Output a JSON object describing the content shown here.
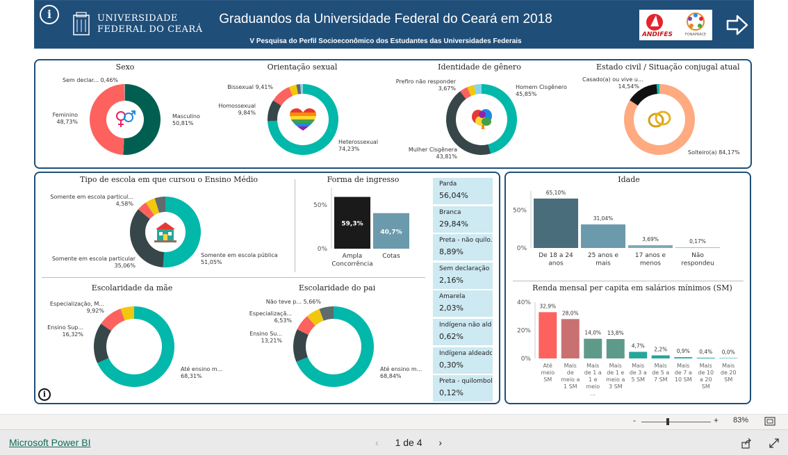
{
  "header": {
    "title": "Graduandos da Universidade Federal do Ceará em 2018",
    "subtitle": "V Pesquisa do Perfil Socioeconômico dos Estudantes das Universidades Federais",
    "university_line1": "Universidade",
    "university_line2": "Federal do Ceará",
    "partner1": "ANDIFES",
    "partner2": "FONAPRACE",
    "info_icon": "i",
    "nav_icon": "arrow-right-icon",
    "colors": {
      "header_bg": "#1f4e79",
      "teal": "#01b8aa",
      "dark": "#374649",
      "red": "#fd625e",
      "yellow": "#f2c80f",
      "gray": "#5f6b6d"
    }
  },
  "charts": {
    "sexo": {
      "title": "Sexo",
      "labels": [
        {
          "name": "Sem declar...",
          "pct": "0,46%"
        },
        {
          "name": "Feminino",
          "pct": "48,73%"
        },
        {
          "name": "Masculino",
          "pct": "50,81%"
        }
      ]
    },
    "orientacao": {
      "title": "Orientação sexual",
      "labels": [
        {
          "name": "Bissexual",
          "pct": "9,41%"
        },
        {
          "name": "Homossexual",
          "pct": "9,84%"
        },
        {
          "name": "Heterossexual",
          "pct": "74,23%"
        }
      ]
    },
    "genero": {
      "title": "Identidade de gênero",
      "labels": [
        {
          "name": "Prefiro não responder",
          "pct": "3,67%"
        },
        {
          "name": "Homem Cisgênero",
          "pct": "45,85%"
        },
        {
          "name": "Mulher Cisgênera",
          "pct": "43,81%"
        }
      ]
    },
    "civil": {
      "title": "Estado civil / Situação conjugal atual",
      "labels": [
        {
          "name": "Casado(a) ou vive u...",
          "pct": "14,54%"
        },
        {
          "name": "Solteiro(a)",
          "pct": "84,17%"
        }
      ]
    },
    "escola": {
      "title": "Tipo de escola em que cursou o Ensino Médio",
      "labels": [
        {
          "name": "Somente em escola particul...",
          "pct": "4,58%"
        },
        {
          "name": "Somente em escola particular",
          "pct": "35,06%"
        },
        {
          "name": "Somente em escola pública",
          "pct": "51,05%"
        }
      ]
    },
    "mae": {
      "title": "Escolaridade da mãe",
      "labels": [
        {
          "name": "Especialização, M...",
          "pct": "9,92%"
        },
        {
          "name": "Ensino Sup...",
          "pct": "16,32%"
        },
        {
          "name": "Até ensino m...",
          "pct": "68,31%"
        }
      ]
    },
    "pai": {
      "title": "Escolaridade do pai",
      "labels": [
        {
          "name": "Não teve p...",
          "pct": "5,66%"
        },
        {
          "name": "Especializaçã...",
          "pct": "6,53%"
        },
        {
          "name": "Ensino Su...",
          "pct": "13,21%"
        },
        {
          "name": "Até ensino m...",
          "pct": "68,84%"
        }
      ]
    }
  },
  "chart_data": [
    {
      "type": "pie",
      "title": "Sexo",
      "categories": [
        "Masculino",
        "Feminino",
        "Sem declar..."
      ],
      "values": [
        50.81,
        48.73,
        0.46
      ]
    },
    {
      "type": "pie",
      "title": "Orientação sexual",
      "categories": [
        "Heterossexual",
        "Homossexual",
        "Bissexual"
      ],
      "values": [
        74.23,
        9.84,
        9.41
      ]
    },
    {
      "type": "pie",
      "title": "Identidade de gênero",
      "categories": [
        "Homem Cisgênero",
        "Mulher Cisgênera",
        "Prefiro não responder"
      ],
      "values": [
        45.85,
        43.81,
        3.67
      ]
    },
    {
      "type": "pie",
      "title": "Estado civil / Situação conjugal atual",
      "categories": [
        "Solteiro(a)",
        "Casado(a) ou vive u..."
      ],
      "values": [
        84.17,
        14.54
      ]
    },
    {
      "type": "pie",
      "title": "Tipo de escola em que cursou o Ensino Médio",
      "categories": [
        "Somente em escola pública",
        "Somente em escola particular",
        "Somente em escola particul..."
      ],
      "values": [
        51.05,
        35.06,
        4.58
      ]
    },
    {
      "type": "pie",
      "title": "Escolaridade da mãe",
      "categories": [
        "Até ensino m...",
        "Ensino Sup...",
        "Especialização, M..."
      ],
      "values": [
        68.31,
        16.32,
        9.92
      ]
    },
    {
      "type": "pie",
      "title": "Escolaridade do pai",
      "categories": [
        "Até ensino m...",
        "Ensino Su...",
        "Especializaçã...",
        "Não teve p..."
      ],
      "values": [
        68.84,
        13.21,
        6.53,
        5.66
      ]
    },
    {
      "type": "bar",
      "title": "Forma de ingresso",
      "categories": [
        "Ampla Concorrência",
        "Cotas"
      ],
      "values": [
        59.3,
        40.7
      ],
      "value_labels": [
        "59,3%",
        "40,7%"
      ],
      "yticks": [
        "50%",
        "0%"
      ],
      "ylim": [
        0,
        70
      ],
      "colors": [
        "#1a1a1a",
        "#6a9aab"
      ]
    },
    {
      "type": "bar",
      "title": "Idade",
      "categories": [
        "De 18 a 24 anos",
        "25 anos e mais",
        "17 anos e menos",
        "Não respondeu"
      ],
      "values": [
        65.1,
        31.04,
        3.69,
        0.17
      ],
      "value_labels": [
        "65,10%",
        "31,04%",
        "3,69%",
        "0,17%"
      ],
      "yticks": [
        "50%",
        "0%"
      ],
      "ylim": [
        0,
        75
      ],
      "colors": [
        "#4a6d7c",
        "#6a9aab",
        "#7fa9b8",
        "#9cc0cc"
      ]
    },
    {
      "type": "bar",
      "title": "Renda mensal per capita em salários mínimos (SM)",
      "categories": [
        "Até meio SM",
        "Mais de meio a 1 SM",
        "Mais de 1 a 1 e meio ...",
        "Mais de 1 e meio a 3 SM",
        "Mais de 3 a 5 SM",
        "Mais de 5 a 7 SM",
        "Mais de 7 a 10 SM",
        "Mais de 10 a 20 SM",
        "Mais de 20 SM"
      ],
      "values": [
        32.9,
        28.0,
        14.0,
        13.8,
        4.7,
        2.2,
        0.9,
        0.4,
        0.0
      ],
      "value_labels": [
        "32,9%",
        "28,0%",
        "14,0%",
        "13,8%",
        "4,7%",
        "2,2%",
        "0,9%",
        "0,4%",
        "0,0%"
      ],
      "yticks": [
        "40%",
        "20%",
        "0%"
      ],
      "ylim": [
        0,
        40
      ],
      "colors": [
        "#fd625e",
        "#c97070",
        "#5e9a8a",
        "#5e9a8a",
        "#26a69a",
        "#26a69a",
        "#26a69a",
        "#26a69a",
        "#26a69a"
      ]
    }
  ],
  "ethnicity": [
    {
      "name": "Parda",
      "value": "56,04%"
    },
    {
      "name": "Branca",
      "value": "29,84%"
    },
    {
      "name": "Preta - não quilo...",
      "value": "8,89%"
    },
    {
      "name": "Sem declaração",
      "value": "2,16%"
    },
    {
      "name": "Amarela",
      "value": "2,03%"
    },
    {
      "name": "Indígena não alde...",
      "value": "0,62%"
    },
    {
      "name": "Indígena aldeado",
      "value": "0,30%"
    },
    {
      "name": "Preta - quilombola",
      "value": "0,12%"
    }
  ],
  "footer": {
    "zoom_minus": "-",
    "zoom_plus": "+",
    "zoom_value": "83%",
    "powerbi_link": "Microsoft Power BI",
    "page_indicator": "1 de 4",
    "prev": "‹",
    "next": "›"
  }
}
